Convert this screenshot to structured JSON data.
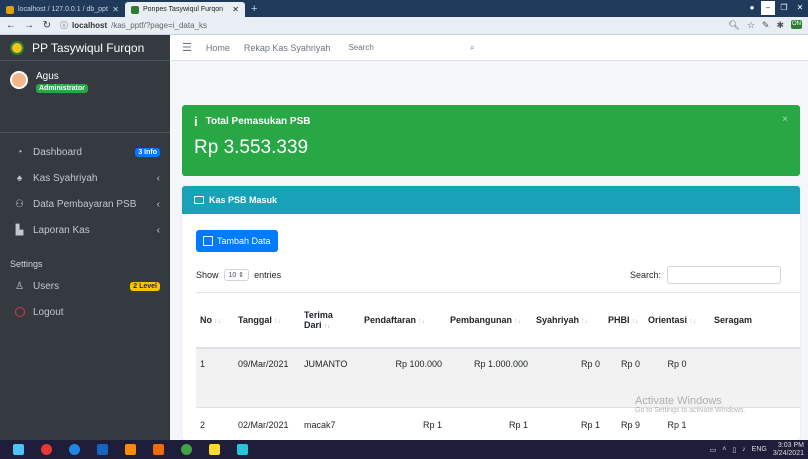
{
  "browser": {
    "tabs": [
      {
        "label": "localhost / 127.0.0.1 / db_ppt"
      },
      {
        "label": "Ponpes Tasywiqul Furqon"
      }
    ],
    "url_host": "localhost",
    "url_path": "/kas_pptf/?page=i_data_ks"
  },
  "sidebar": {
    "brand": "PP Tasywiqul Furqon",
    "user": {
      "name": "Agus",
      "role": "Administrator"
    },
    "items": [
      {
        "label": "Dashboard",
        "badge": "3 Info"
      },
      {
        "label": "Kas Syahriyah"
      },
      {
        "label": "Data Pembayaran PSB"
      },
      {
        "label": "Laporan Kas"
      }
    ],
    "settings_header": "Settings",
    "users": {
      "label": "Users",
      "badge": "2 Level"
    },
    "logout": "Logout"
  },
  "topbar": {
    "home": "Home",
    "rekap": "Rekap Kas Syahriyah",
    "search_placeholder": "Search"
  },
  "alert": {
    "title": "Total Pemasukan PSB",
    "amount": "Rp 3.553.339"
  },
  "card": {
    "title": "Kas PSB Masuk",
    "add_button": "Tambah Data",
    "show": "Show",
    "entries_value": "10",
    "entries": "entries",
    "search_label": "Search:"
  },
  "table": {
    "headers": [
      "No",
      "Tanggal",
      "Terima Dari",
      "Pendaftaran",
      "Pembangunan",
      "Syahriyah",
      "PHBI",
      "Orientasi",
      "Seragam"
    ],
    "rows": [
      [
        "1",
        "09/Mar/2021",
        "JUMANTO",
        "Rp 100.000",
        "Rp 1.000.000",
        "Rp 0",
        "Rp 0",
        "Rp 0",
        ""
      ],
      [
        "2",
        "02/Mar/2021",
        "macak7",
        "Rp 1",
        "Rp 1",
        "Rp 1",
        "Rp 9",
        "Rp 1",
        ""
      ]
    ]
  },
  "watermark": {
    "title": "Activate Windows",
    "sub": "Go to Settings to activate Windows."
  },
  "taskbar": {
    "lang": "ENG",
    "time": "3:03 PM",
    "date": "3/24/2021"
  },
  "colors": {
    "success": "#28a745",
    "info": "#17a2b8",
    "primary": "#007bff",
    "sidebar": "#343a40"
  }
}
